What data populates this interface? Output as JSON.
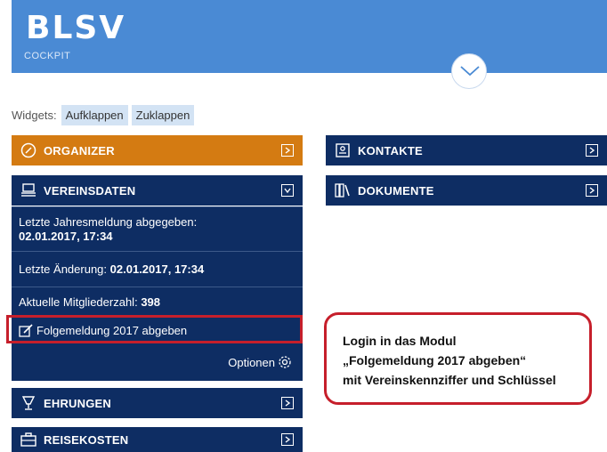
{
  "header": {
    "logo_text": "BLSV",
    "logo_sub": "COCKPIT",
    "expand_icon": "chevron-down-icon"
  },
  "widgets": {
    "label": "Widgets:",
    "expand_label": "Aufklappen",
    "collapse_label": "Zuklappen"
  },
  "panels": {
    "organizer": {
      "title": "ORGANIZER",
      "icon": "compass-icon",
      "color": "#d47b12"
    },
    "vereinsdaten": {
      "title": "VEREINSDATEN",
      "icon": "stack-icon"
    },
    "kontakte": {
      "title": "KONTAKTE",
      "icon": "contact-card-icon"
    },
    "dokumente": {
      "title": "DOKUMENTE",
      "icon": "books-icon"
    },
    "ehrungen": {
      "title": "EHRUNGEN",
      "icon": "trophy-icon"
    },
    "reisekosten": {
      "title": "REISEKOSTEN",
      "icon": "suitcase-icon"
    }
  },
  "vereinsdaten": {
    "jahresmeldung_label": "Letzte Jahresmeldung abgegeben:",
    "jahresmeldung_value": "02.01.2017, 17:34",
    "aenderung_label": "Letzte Änderung:",
    "aenderung_value": "02.01.2017, 17:34",
    "mitglieder_label": "Aktuelle Mitgliederzahl:",
    "mitglieder_value": "398",
    "folgemeldung_link": "Folgemeldung 2017 abgeben",
    "optionen_label": "Optionen"
  },
  "callout": {
    "line1": "Login in das Modul",
    "line2": "„Folgemeldung 2017 abgeben“",
    "line3": "mit Vereinskennziffer und Schlüssel"
  },
  "colors": {
    "header_blue": "#4a8ad4",
    "panel_navy": "#0e2d63",
    "organizer_orange": "#d47b12",
    "highlight_red": "#c61f2b"
  }
}
